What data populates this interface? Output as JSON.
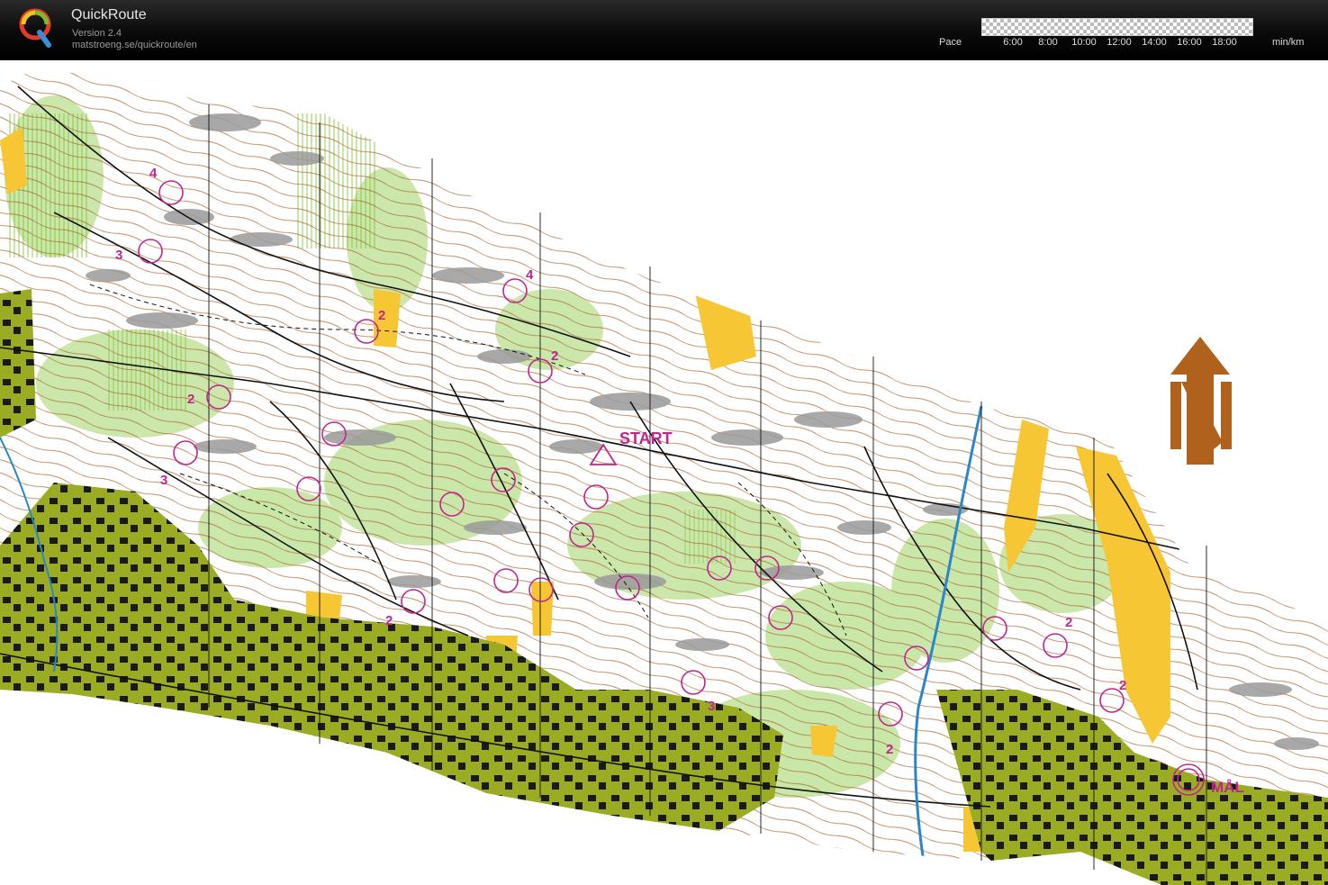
{
  "app": {
    "title": "QuickRoute",
    "version": "Version 2.4",
    "url": "matstroeng.se/quickroute/en"
  },
  "pace_scale": {
    "label": "Pace",
    "unit": "min/km",
    "ticks": [
      "6:00",
      "8:00",
      "10:00",
      "12:00",
      "14:00",
      "16:00",
      "18:00"
    ]
  },
  "map": {
    "start_label": "START",
    "finish_label": "MÅL",
    "north_label": "N",
    "colors": {
      "forest_white": "#ffffff",
      "light_green": "#c8e6a6",
      "open_yellow": "#f7c634",
      "settlement_olive": "#9cac22",
      "rock_grey": "#9a9a9a",
      "contour_brown": "#a8632a",
      "course_magenta": "#c0268e",
      "water_blue": "#2a86c8",
      "track_black": "#111111"
    },
    "controls": [
      {
        "label": "4"
      },
      {
        "label": "3"
      },
      {
        "label": "2"
      },
      {
        "label": "2"
      },
      {
        "label": "3"
      },
      {
        "label": "4"
      },
      {
        "label": "2"
      },
      {
        "label": "2"
      },
      {
        "label": "3"
      },
      {
        "label": "2"
      },
      {
        "label": "2"
      },
      {
        "label": "2"
      }
    ]
  }
}
